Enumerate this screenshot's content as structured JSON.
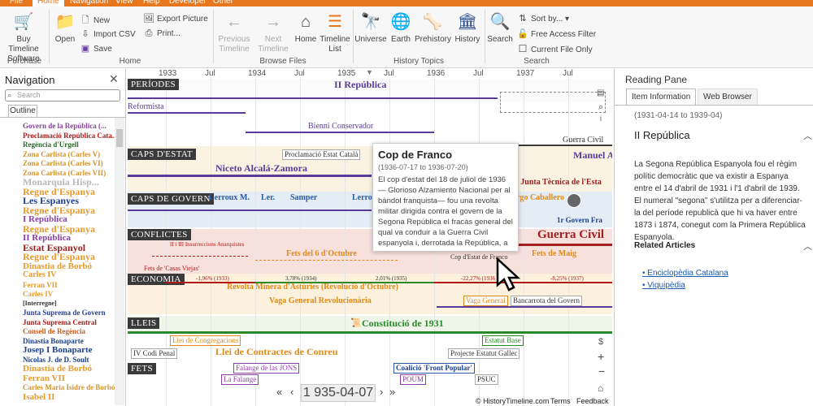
{
  "menu": [
    "File",
    "Home",
    "Navigation",
    "View",
    "Help",
    "Developer",
    "Other"
  ],
  "menu_active": "Home",
  "ribbon": {
    "buy_label": "Buy Timeline Software",
    "open_label": "Open",
    "new_label": "New",
    "import_csv_label": "Import CSV",
    "save_label": "Save",
    "export_picture_label": "Export Picture",
    "print_label": "Print...",
    "previous_label": "Previous Timeline",
    "next_label": "Next Timeline",
    "home_label": "Home",
    "timeline_list_label": "Timeline List",
    "universe_label": "Universe",
    "earth_label": "Earth",
    "prehistory_label": "Prehistory",
    "history_label": "History",
    "search_label": "Search",
    "sort_by_label": "Sort by...",
    "free_access_label": "Free Access Filter",
    "current_file_label": "Current File Only",
    "groups": [
      "Purchase",
      "Home",
      "Browse Files",
      "History Topics",
      "Search"
    ]
  },
  "nav": {
    "title": "Navigation",
    "search_placeholder": "Search",
    "tab": "Outline",
    "items": [
      {
        "label": "Govern de la República (...",
        "color": "#8e3fa6",
        "size": 9
      },
      {
        "label": "Proclamació República Cata...",
        "color": "#b11a1a",
        "size": 9
      },
      {
        "label": "Regència d'Urgell",
        "color": "#2a6a2a",
        "size": 9
      },
      {
        "label": "Zona Carlista (Carles V)",
        "color": "#d6932a",
        "size": 9
      },
      {
        "label": "Zona Carlista (Carles VI)",
        "color": "#d6932a",
        "size": 9
      },
      {
        "label": "Zona Carlista (Carles VII)",
        "color": "#d6932a",
        "size": 9
      },
      {
        "label": "Monarquia Hisp...",
        "color": "#b8b8b8",
        "size": 12
      },
      {
        "label": "Regne d'Espanya",
        "color": "#e79a2d",
        "size": 12
      },
      {
        "label": "Les Espanyes",
        "color": "#1b3f91",
        "size": 12
      },
      {
        "label": "Regne d'Espanya",
        "color": "#e79a2d",
        "size": 12
      },
      {
        "label": "I República",
        "color": "#8a3fa8",
        "size": 11
      },
      {
        "label": "Regne d'Espanya",
        "color": "#e79a2d",
        "size": 12
      },
      {
        "label": "II República",
        "color": "#8a3fa8",
        "size": 11
      },
      {
        "label": "Estat Espanyol",
        "color": "#a02020",
        "size": 12
      },
      {
        "label": "Regne d'Espanya",
        "color": "#e79a2d",
        "size": 12
      },
      {
        "label": "Dinastia de Borbó",
        "color": "#e79a2d",
        "size": 11
      },
      {
        "label": "Carles IV",
        "color": "#e79a2d",
        "size": 10
      },
      {
        "label": "Ferran VII",
        "color": "#e79a2d",
        "size": 9
      },
      {
        "label": "Carles IV",
        "color": "#e79a2d",
        "size": 9
      },
      {
        "label": "[Interregne]",
        "color": "#333333",
        "size": 8
      },
      {
        "label": "Junta Suprema de Govern",
        "color": "#2a3f91",
        "size": 9
      },
      {
        "label": "Junta Suprema Central",
        "color": "#a02020",
        "size": 9
      },
      {
        "label": "Consell de Regència",
        "color": "#d05a1a",
        "size": 9
      },
      {
        "label": "Dinastia Bonaparte",
        "color": "#1b3f91",
        "size": 9
      },
      {
        "label": "Josep I Bonaparte",
        "color": "#1b3f91",
        "size": 11
      },
      {
        "label": "Nicolas J. de D. Soult",
        "color": "#1b3f91",
        "size": 9
      },
      {
        "label": "Dinastia de Borbó",
        "color": "#e79a2d",
        "size": 11
      },
      {
        "label": "Ferran VII",
        "color": "#e79a2d",
        "size": 11
      },
      {
        "label": "Carles Maria Isidre de Borbó",
        "color": "#d6932a",
        "size": 9
      },
      {
        "label": "Isabel II",
        "color": "#e79a2d",
        "size": 11
      }
    ]
  },
  "timeline": {
    "years": [
      "1933",
      "Jul",
      "1934",
      "Jul",
      "1935",
      "Jul",
      "1936",
      "Jul",
      "1937",
      "Jul"
    ],
    "date_display": "1 935-04-07",
    "band_labels": [
      "PERÍODES",
      "CAPS D'ESTAT",
      "CAPS DE GOVERN",
      "CONFLICTES",
      "ECONOMIA",
      "LLEIS",
      "FETS"
    ],
    "events": {
      "ii_republica": "II República",
      "reformista": "Reformista",
      "bienni": "Bienni Conservador",
      "guerra_civil": "Guerra Civil",
      "proclamacio": "Proclamació Estat Català",
      "alcala": "Niceto Alcalá-Zamora",
      "azana": "Manuel Aza",
      "junta": "l Junta Tècnica de l'Esta",
      "lerroux1": "Lerroux",
      "m": "M.",
      "ler": "Ler.",
      "samper": "Samper",
      "lerro": "Lerro",
      "caballero": "rgo Caballero",
      "govern_franco": "1r Govern Fra",
      "inssurreccions": "II i III Insurreccions Anarquistes",
      "casas_viejas": "Fets de 'Casas Viejas'",
      "fets6": "Fets del 6 d'Octubre",
      "cop_franco": "Cop d'Estat de Franco",
      "fets_maig": "Fets de Maig",
      "guerra_civil_big": "Guerra Civil",
      "eco1": "-1,96% (1933)",
      "eco2": "3,78% (1934)",
      "eco3": "2,01% (1935)",
      "eco4": "-22,27% (1936",
      "eco5": "-8,25% (1937)",
      "revolta": "Revolta Minera d'Astúries (Revolució d'Octubre)",
      "vaga_rev": "Vaga General Revolucionària",
      "vaga_gen": "Vaga General",
      "bancarrota": "Bancarrota del Govern",
      "constitucio": "Constitució de 1931",
      "congregacions": "Llei de Congregacions",
      "contractes": "Llei de Contractes de Conreu",
      "codi_penal": "IV Codi Penal",
      "estatut_base": "Estatut Base",
      "projecte": "Projecte Estatut Gallec",
      "falange_jons": "Falange de las JONS",
      "falange": "La Falange",
      "front_popular": "Coalició 'Front Popular'",
      "poum": "POUM",
      "psuc": "PSUC"
    },
    "popup": {
      "title": "Cop de Franco",
      "dates": "(1936-07-17 to 1936-07-20)",
      "body": "El cop d'estat del 18 de juliol de 1936 — Glorioso Alzamiento Nacional per al bàndol franquista— fou una revolta militar dirigida contra el govern de la Segona República el fracàs general del qual va conduir a la Guerra Civil espanyola i, derrotada la República, a"
    },
    "footer": {
      "copyright": "© HistoryTimeline.com",
      "terms": "Terms",
      "feedback": "Feedback"
    }
  },
  "reading_pane": {
    "title": "Reading Pane",
    "tabs": [
      "Item Information",
      "Web Browser"
    ],
    "dates": "(1931-04-14 to 1939-04)",
    "heading": "II República",
    "body": "La Segona República Espanyola fou el règim polític democràtic que va existir a Espanya entre el 14 d'abril de 1931 i l'1 d'abril de 1939. El numeral \"segona\" s'utilitza per a diferenciar-la del període republicà que hi va haver entre 1873 i 1874, conegut com la Primera República Espanyola.",
    "related_title": "Related Articles",
    "links": [
      "Enciclopèdia Catalana",
      "Viquipèdia"
    ]
  },
  "colors": {
    "accent": "#e8761c",
    "purple": "#5a3a9a",
    "red": "#b11a1a",
    "orange": "#e08a1a",
    "green": "#2a8a2a",
    "blue": "#2a5aa8"
  }
}
